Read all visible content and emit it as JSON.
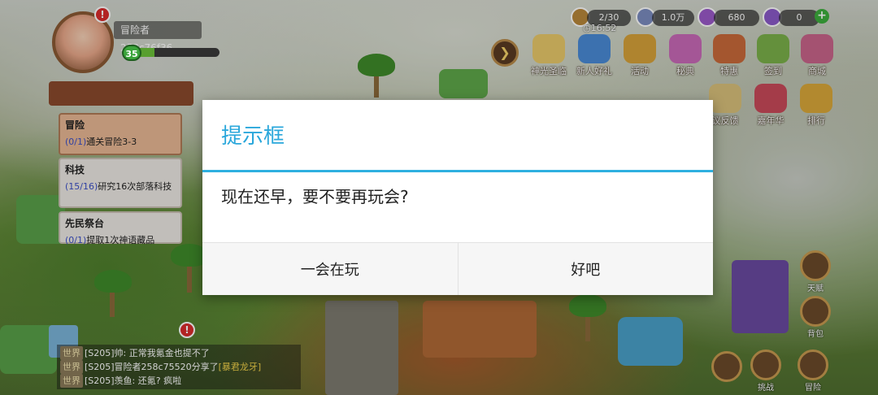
{
  "player": {
    "name": "冒险者258c76f36",
    "level": "35",
    "xp_fraction": 0.22,
    "alert": "!"
  },
  "resources": [
    {
      "value": "2/30",
      "color": "#b8873a"
    },
    {
      "value": "1.0万",
      "color": "#7a8bbf"
    },
    {
      "value": "680",
      "color": "#9a5ac9"
    },
    {
      "value": "0",
      "color": "#8a5ac9"
    }
  ],
  "timer": "16:52",
  "top_menu": [
    {
      "label": "神光圣临",
      "icon": "angel-wings-icon",
      "color": "#e8c86a"
    },
    {
      "label": "新人好礼",
      "icon": "hero-portrait-icon",
      "color": "#4a8ad6"
    },
    {
      "label": "活动",
      "icon": "activity-star-icon",
      "color": "#d6a23a"
    },
    {
      "label": "秘典",
      "icon": "secret-book-icon",
      "color": "#c86ab8"
    },
    {
      "label": "特惠",
      "icon": "gift-box-icon",
      "color": "#c9693a"
    },
    {
      "label": "签到",
      "icon": "checkin-scroll-icon",
      "color": "#7ab04a"
    },
    {
      "label": "商城",
      "icon": "shop-cart-icon",
      "color": "#c8648a"
    }
  ],
  "second_menu": [
    {
      "label": "议反馈",
      "icon": "feedback-scroll-icon",
      "color": "#d8c07a"
    },
    {
      "label": "嘉年华",
      "icon": "carnival-tent-icon",
      "color": "#c84a5a"
    },
    {
      "label": "排行",
      "icon": "trophy-icon",
      "color": "#d9a83a"
    }
  ],
  "side_buttons": [
    {
      "label": "天赋",
      "icon": "talent-scroll-icon"
    },
    {
      "label": "背包",
      "icon": "backpack-icon"
    },
    {
      "label": "挑战",
      "icon": "crossed-swords-icon"
    },
    {
      "label": "冒险",
      "icon": "adventure-helmet-icon"
    }
  ],
  "quests": [
    {
      "title": "冒险",
      "progress": "(0/1)",
      "desc": "通关冒险3-3",
      "active": true
    },
    {
      "title": "科技",
      "progress": "(15/16)",
      "desc": "研究16次部落科技",
      "active": false
    },
    {
      "title": "先民祭台",
      "progress": "(0/1)",
      "desc": "提取1次神语藏品",
      "active": false
    }
  ],
  "chat": [
    {
      "channel": "世界",
      "text": "[S205]帅: 正常我氪金也提不了",
      "highlight": ""
    },
    {
      "channel": "世界",
      "text": "[S205]冒险者258c75520分享了",
      "highlight": "[暴君龙牙]"
    },
    {
      "channel": "世界",
      "text": "[S205]羡鱼: 还氪? 疯啦",
      "highlight": ""
    }
  ],
  "dialog": {
    "title": "提示框",
    "message": "现在还早，要不要再玩会?",
    "cancel_label": "一会在玩",
    "confirm_label": "好吧"
  }
}
